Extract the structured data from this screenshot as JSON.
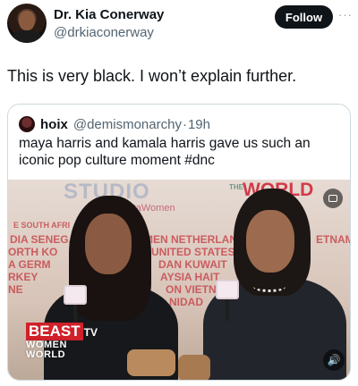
{
  "author": {
    "display_name": "Dr. Kia Conerway",
    "handle": "@drkiaconerway",
    "follow_label": "Follow",
    "more_glyph": "···"
  },
  "tweet": {
    "text": "This is very black. I won’t explain further."
  },
  "quoted_tweet": {
    "display_name": "hoix",
    "handle": "@demismonarchy",
    "separator": "·",
    "time": "19h",
    "text": "maya harris and kamala harris gave us such an iconic pop culture moment #dnc"
  },
  "video": {
    "backdrop_studio": "STUDIO",
    "backdrop_sub": "byotaWomen",
    "backdrop_the": "THE",
    "backdrop_world": "WORLD",
    "countries": [
      "DIA SENEGAL B",
      "ORTH KO",
      "A GERM",
      "RKEY",
      "NE",
      "MEN NETHERLANDS JORD",
      "UNITED STATES MAL",
      "DAN KUWAIT",
      "AYSIA HAIT",
      "ON VIETN",
      "NIDAD",
      "ETNAM",
      "E SOUTH AFRI"
    ],
    "channel_word": "BEAST",
    "channel_suffix": "TV",
    "watermark_line1": "WOMEN",
    "watermark_line2": "WORLD",
    "captions_icon": "captions-icon",
    "sound_icon": "speaker-icon",
    "sound_glyph": "🔊"
  },
  "colors": {
    "follow_bg": "#0f1419",
    "secondary_text": "#536471",
    "border": "#cfd9de",
    "world_red": "#d23a48"
  }
}
